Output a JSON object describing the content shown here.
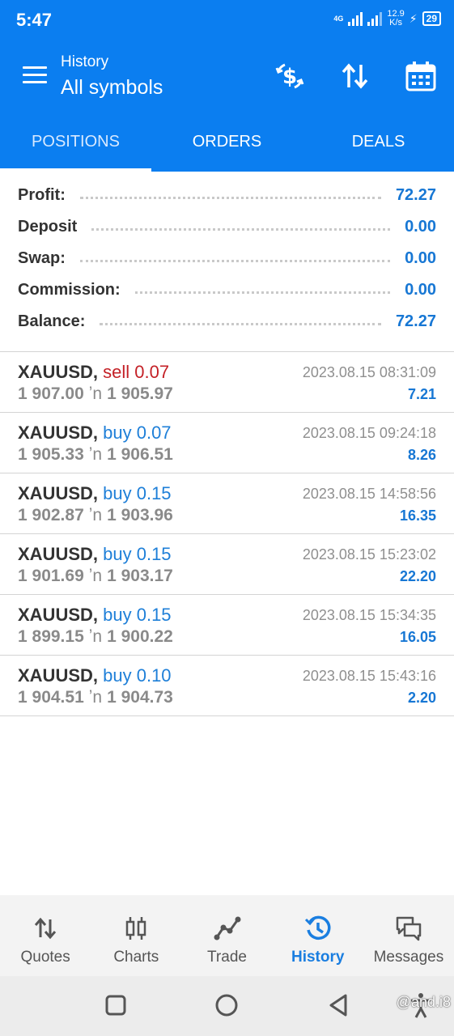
{
  "status_bar": {
    "time": "5:47",
    "network": "4G",
    "speed_value": "12.9",
    "speed_unit": "K/s",
    "battery": "29"
  },
  "app_bar": {
    "subtitle": "History",
    "title": "All symbols",
    "icons": [
      "menu-icon",
      "currency-exchange-icon",
      "sort-icon",
      "calendar-icon"
    ]
  },
  "tabs": [
    {
      "label": "POSITIONS",
      "active": true
    },
    {
      "label": "ORDERS",
      "active": false
    },
    {
      "label": "DEALS",
      "active": false
    }
  ],
  "summary": {
    "profit": {
      "label": "Profit:",
      "value": "72.27"
    },
    "deposit": {
      "label": "Deposit",
      "value": "0.00"
    },
    "swap": {
      "label": "Swap:",
      "value": "0.00"
    },
    "commission": {
      "label": "Commission:",
      "value": "0.00"
    },
    "balance": {
      "label": "Balance:",
      "value": "72.27"
    }
  },
  "deals": [
    {
      "symbol": "XAUUSD,",
      "action": "sell 0.07",
      "side": "sell",
      "open": "1 907.00",
      "arrow": "ʼn",
      "close": "1 905.97",
      "time": "2023.08.15 08:31:09",
      "profit": "7.21"
    },
    {
      "symbol": "XAUUSD,",
      "action": "buy 0.07",
      "side": "buy",
      "open": "1 905.33",
      "arrow": "ʼn",
      "close": "1 906.51",
      "time": "2023.08.15 09:24:18",
      "profit": "8.26"
    },
    {
      "symbol": "XAUUSD,",
      "action": "buy 0.15",
      "side": "buy",
      "open": "1 902.87",
      "arrow": "ʼn",
      "close": "1 903.96",
      "time": "2023.08.15 14:58:56",
      "profit": "16.35"
    },
    {
      "symbol": "XAUUSD,",
      "action": "buy 0.15",
      "side": "buy",
      "open": "1 901.69",
      "arrow": "ʼn",
      "close": "1 903.17",
      "time": "2023.08.15 15:23:02",
      "profit": "22.20"
    },
    {
      "symbol": "XAUUSD,",
      "action": "buy 0.15",
      "side": "buy",
      "open": "1 899.15",
      "arrow": "ʼn",
      "close": "1 900.22",
      "time": "2023.08.15 15:34:35",
      "profit": "16.05"
    },
    {
      "symbol": "XAUUSD,",
      "action": "buy 0.10",
      "side": "buy",
      "open": "1 904.51",
      "arrow": "ʼn",
      "close": "1 904.73",
      "time": "2023.08.15 15:43:16",
      "profit": "2.20"
    }
  ],
  "bottom_nav": [
    {
      "label": "Quotes",
      "icon": "quotes-icon",
      "active": false
    },
    {
      "label": "Charts",
      "icon": "charts-icon",
      "active": false
    },
    {
      "label": "Trade",
      "icon": "trade-icon",
      "active": false
    },
    {
      "label": "History",
      "icon": "history-icon",
      "active": true
    },
    {
      "label": "Messages",
      "icon": "messages-icon",
      "active": false
    }
  ],
  "watermark": "@and.i8",
  "colors": {
    "brand": "#0b7ef0",
    "profit_blue": "#1777d4",
    "sell_red": "#c42127",
    "buy_blue": "#1e7fd8",
    "nav_active": "#1a7ee0"
  }
}
